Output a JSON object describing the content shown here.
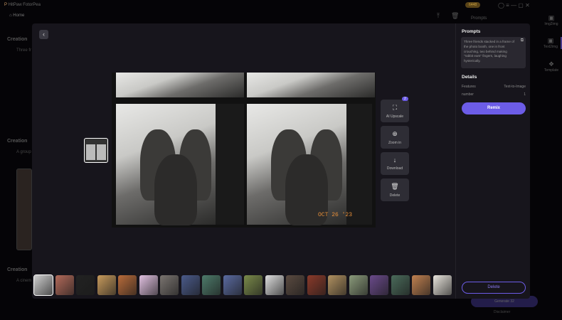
{
  "app": {
    "title": "HitPaw FotorPea",
    "home": "Home",
    "credits": "6448"
  },
  "background": {
    "sections": [
      {
        "title": "Creation",
        "desc": "Three fr"
      },
      {
        "title": "Creation",
        "desc": "A group"
      },
      {
        "title": "Creation",
        "desc": "A cinem"
      }
    ],
    "prompts_label": "Prompts",
    "generate": "Generate",
    "generate_cost": "32",
    "disclaimer": "Disclaimer",
    "side_tabs": [
      "Img2img",
      "Text2img",
      "Template"
    ]
  },
  "viewer": {
    "date_stamp": "OCT 26 '23",
    "badge": "2",
    "actions": [
      {
        "label": "AI Upscale",
        "icon": "⛶"
      },
      {
        "label": "Zoom in",
        "icon": "⊕"
      },
      {
        "label": "Download",
        "icon": "↓"
      },
      {
        "label": "Delete",
        "icon": "🗑"
      }
    ],
    "thumbnail_colors": [
      "#cfcfcf",
      "#b26a5a",
      "#222",
      "#c79a5c",
      "#b86b3a",
      "#e0c0e0",
      "#7a7470",
      "#4a5a8a",
      "#4d7a6a",
      "#5a6aa0",
      "#7a8a4a",
      "#ddd",
      "#5a4a40",
      "#8a3a2a",
      "#b09060",
      "#8a9a7a",
      "#6a4a8a",
      "#4a6a5a",
      "#c08050",
      "#e8e4dc"
    ]
  },
  "panel": {
    "prompts_title": "Prompts",
    "prompt": "Three friends stacked in a frame of the photo booth, one in front crouching, two behind making \"rabbit ears\" fingers, laughing hysterically.",
    "details_title": "Details",
    "details": [
      {
        "key": "Features",
        "value": "Text-to-Image"
      },
      {
        "key": "number",
        "value": "1"
      }
    ],
    "remix": "Remix",
    "delete": "Delete",
    "accent": "#6c5ce7"
  }
}
